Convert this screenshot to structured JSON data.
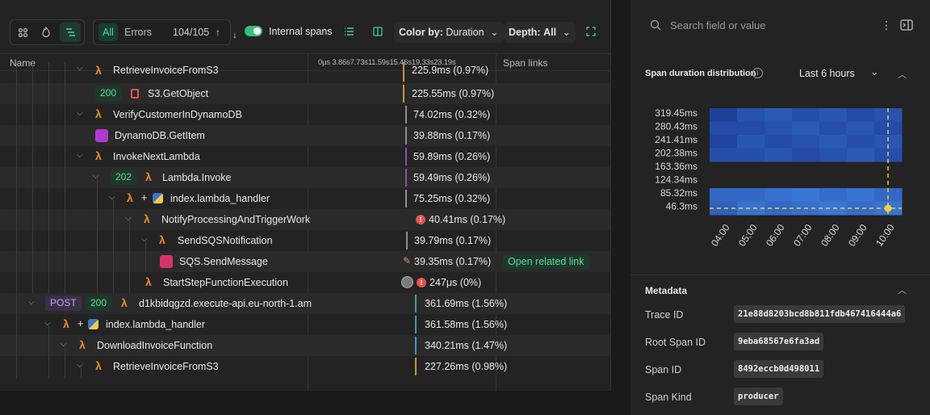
{
  "toolbar": {
    "filter_all": "All",
    "filter_errors": "Errors",
    "match_count": "104/105",
    "internal_spans_label": "Internal spans",
    "color_by_label": "Color by:",
    "color_by_value": "Duration",
    "depth_label": "Depth:",
    "depth_value": "All",
    "internal_spans_enabled": true
  },
  "columns": {
    "name": "Name",
    "timeline_ticks": "0μs  3.86s7.73s11.59s15.46s19.33s23.19s",
    "span_links": "Span links"
  },
  "rows": [
    {
      "name": "RetrieveInvoiceFromS3",
      "duration": "225.9ms (0.97%)",
      "bar_color": "#c59436"
    },
    {
      "name": "S3.GetObject",
      "status": "200",
      "duration": "225.55ms (0.97%)",
      "bar_color": "#c59436"
    },
    {
      "name": "VerifyCustomerInDynamoDB",
      "duration": "74.02ms (0.32%)",
      "bar_color": "#8e8e8e"
    },
    {
      "name": "DynamoDB.GetItem",
      "duration": "39.88ms (0.17%)",
      "bar_color": "#8e8e8e"
    },
    {
      "name": "InvokeNextLambda",
      "duration": "59.89ms (0.26%)",
      "bar_color": "#7a5aa6"
    },
    {
      "name": "Lambda.Invoke",
      "status": "202",
      "duration": "59.49ms (0.26%)",
      "bar_color": "#7a5aa6"
    },
    {
      "name": "index.lambda_handler",
      "duration": "75.25ms (0.32%)",
      "bar_color": "#8e8e8e"
    },
    {
      "name": "NotifyProcessingAndTriggerWork",
      "duration": "40.41ms (0.17%)",
      "error": true
    },
    {
      "name": "SendSQSNotification",
      "duration": "39.79ms (0.17%)",
      "bar_color": "#8e8e8e"
    },
    {
      "name": "SQS.SendMessage",
      "duration": "39.35ms (0.17%)",
      "span_link": "Open related link"
    },
    {
      "name": "StartStepFunctionExecution",
      "duration": "247μs (0%)",
      "error": true
    },
    {
      "name": "d1kbidqgzd.execute-api.eu-north-1.am",
      "method": "POST",
      "status": "200",
      "duration": "361.69ms (1.56%)",
      "bar_color": "#4a9aa6"
    },
    {
      "name": "index.lambda_handler",
      "duration": "361.58ms (1.56%)",
      "bar_color": "#4a9aa6"
    },
    {
      "name": "DownloadInvoiceFunction",
      "duration": "340.21ms (1.47%)",
      "bar_color": "#4a9aa6"
    },
    {
      "name": "RetrieveInvoiceFromS3",
      "duration": "227.26ms (0.98%)",
      "bar_color": "#c59436"
    }
  ],
  "right": {
    "search_placeholder": "Search field or value",
    "distribution_title": "Span duration distribution",
    "time_range": "Last 6 hours",
    "metadata_title": "Metadata",
    "metadata": [
      {
        "key": "Trace ID",
        "value": "21e88d8203bcd8b811fdb467416444a6"
      },
      {
        "key": "Root Span ID",
        "value": "9eba68567e6fa3ad"
      },
      {
        "key": "Span ID",
        "value": "8492eccb0d498011"
      },
      {
        "key": "Span Kind",
        "value": "producer"
      }
    ]
  },
  "chart_data": {
    "type": "heatmap",
    "title": "Span duration distribution",
    "y_tick_labels": [
      "319.45ms",
      "280.43ms",
      "241.41ms",
      "202.38ms",
      "163.36ms",
      "124.34ms",
      "85.32ms",
      "46.3ms"
    ],
    "x_tick_labels": [
      "04:00",
      "05:00",
      "06:00",
      "07:00",
      "08:00",
      "09:00",
      "10:00"
    ],
    "selected_y": "46.3ms",
    "selected_x": "10:00",
    "colors": {
      "low": "#1a3f9a",
      "high": "#3a78d8",
      "marker": "#f2d23a"
    }
  }
}
